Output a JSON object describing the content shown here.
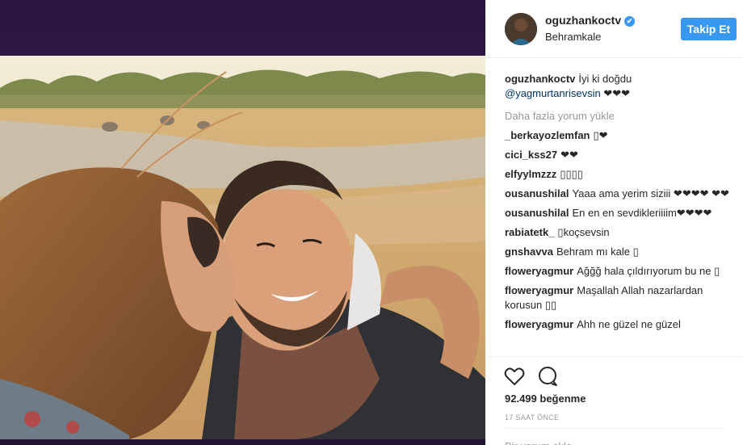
{
  "post": {
    "username": "oguzhankoctv",
    "verified_mark": "✔",
    "location": "Behramkale",
    "follow_label": "Takip Et",
    "caption": {
      "username": "oguzhankoctv",
      "text": "İyi ki doğdu",
      "mention": "@yagmurtanrisevsin",
      "suffix": "❤❤❤"
    },
    "load_more_label": "Daha fazla yorum yükle",
    "comments": [
      {
        "user": "_berkayozlemfan",
        "text": "▯❤"
      },
      {
        "user": "cici_kss27",
        "text": "❤❤"
      },
      {
        "user": "elfyylmzzz",
        "text": "▯▯▯▯"
      },
      {
        "user": "ousanushilal",
        "text": "Yaaa ama yerim siziii ❤❤❤❤ ❤❤"
      },
      {
        "user": "ousanushilal",
        "text": "En en en sevdikleriiiim❤❤❤❤"
      },
      {
        "user": "rabiatetk_",
        "text": "▯koçsevsin"
      },
      {
        "user": "gnshavva",
        "text": "Behram mı kale ▯"
      },
      {
        "user": "floweryagmur",
        "text": "Ağğğ hala çıldırıyorum bu ne ▯"
      },
      {
        "user": "floweryagmur",
        "text": "Maşallah Allah nazarlardan korusun ▯▯"
      },
      {
        "user": "floweryagmur",
        "text": "Ahh ne güzel ne güzel"
      }
    ],
    "likes": "92.499 beğenme",
    "time": "17 SAAT ÖNCE",
    "add_comment_placeholder": "Bir yorum ekle...",
    "icons": {
      "like": "heart-icon",
      "comment": "comment-bubble-icon"
    }
  },
  "colors": {
    "accent": "#3897f0",
    "mention": "#003569",
    "muted": "#999999",
    "backdrop": "#2b1640"
  }
}
